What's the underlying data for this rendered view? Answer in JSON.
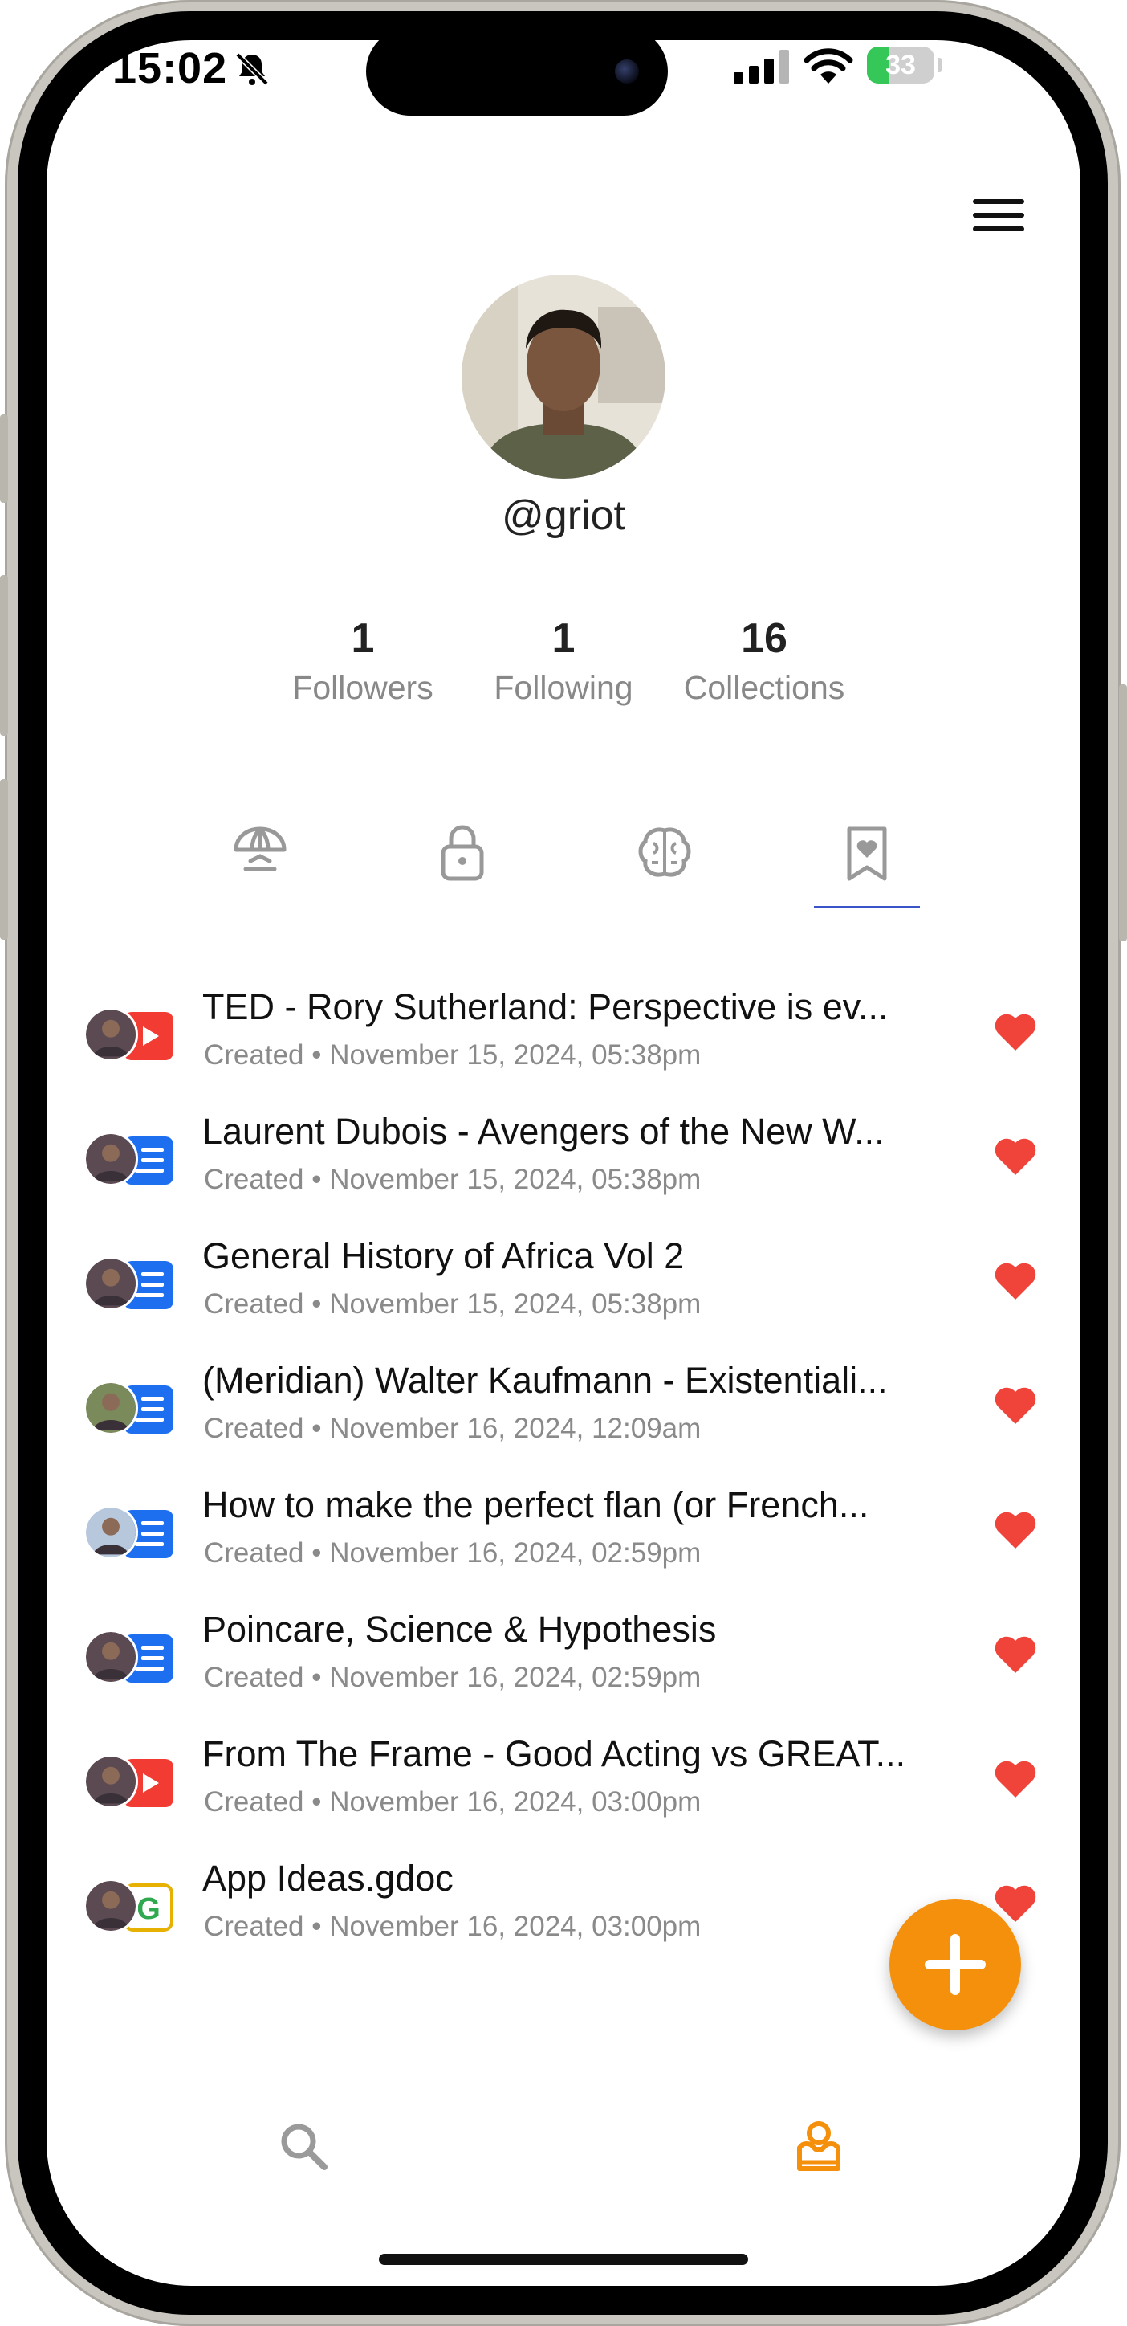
{
  "status_bar": {
    "time": "15:02",
    "battery": "33",
    "battery_level": 0.33
  },
  "profile": {
    "username": "@griot",
    "stats": [
      {
        "value": "1",
        "label": "Followers"
      },
      {
        "value": "1",
        "label": "Following"
      },
      {
        "value": "16",
        "label": "Collections"
      }
    ]
  },
  "tabs": [
    {
      "icon": "umbrella-icon"
    },
    {
      "icon": "lock-icon"
    },
    {
      "icon": "brain-icon"
    },
    {
      "icon": "bookmark-heart-icon",
      "active": true
    }
  ],
  "items": [
    {
      "title": "TED - Rory Sutherland: Perspective is ev...",
      "status": "Created",
      "date": "November 15, 2024, 05:38pm",
      "source_icon": "youtube-icon",
      "liked": true
    },
    {
      "title": "Laurent Dubois - Avengers of the New W...",
      "status": "Created",
      "date": "November 15, 2024, 05:38pm",
      "source_icon": "document-icon",
      "liked": true
    },
    {
      "title": "General History of Africa Vol 2",
      "status": "Created",
      "date": "November 15, 2024, 05:38pm",
      "source_icon": "document-icon",
      "liked": true
    },
    {
      "title": "(Meridian) Walter Kaufmann - Existentiali...",
      "status": "Created",
      "date": "November 16, 2024, 12:09am",
      "source_icon": "document-icon",
      "liked": true
    },
    {
      "title": "How to make the perfect flan (or French...",
      "status": "Created",
      "date": "November 16, 2024, 02:59pm",
      "source_icon": "document-icon",
      "liked": true
    },
    {
      "title": "Poincare, Science & Hypothesis",
      "status": "Created",
      "date": "November 16, 2024, 02:59pm",
      "source_icon": "document-icon",
      "liked": true
    },
    {
      "title": "From The Frame - Good Acting vs GREAT...",
      "status": "Created",
      "date": "November 16, 2024, 03:00pm",
      "source_icon": "youtube-icon",
      "liked": true
    },
    {
      "title": "App Ideas.gdoc",
      "status": "Created",
      "date": "November 16, 2024, 03:00pm",
      "source_icon": "google-doc-icon",
      "liked": true
    }
  ],
  "colors": {
    "accent": "#f4900c",
    "heart": "#f0433a",
    "tab_underline": "#3a55c7",
    "doc_badge": "#1e6ff0",
    "youtube": "#f23c33"
  }
}
